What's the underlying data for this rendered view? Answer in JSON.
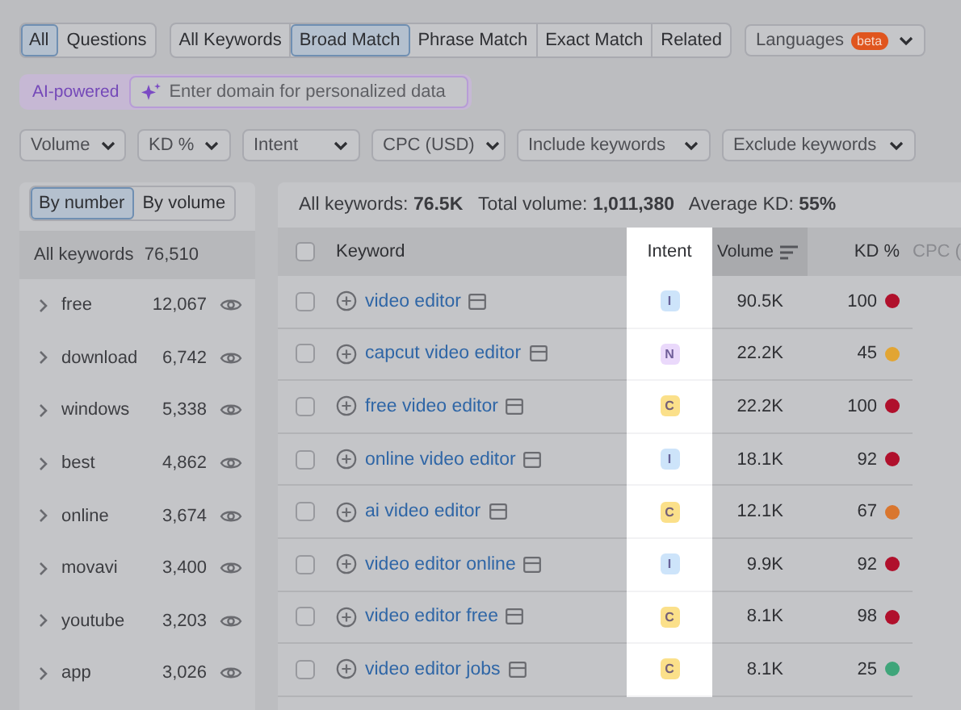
{
  "match_tabs": [
    {
      "label": "All",
      "selected": true
    },
    {
      "label": "Questions",
      "selected": false
    }
  ],
  "type_tabs": [
    {
      "label": "All Keywords",
      "selected": false
    },
    {
      "label": "Broad Match",
      "selected": true
    },
    {
      "label": "Phrase Match",
      "selected": false
    },
    {
      "label": "Exact Match",
      "selected": false
    },
    {
      "label": "Related",
      "selected": false
    }
  ],
  "languages": {
    "label": "Languages",
    "badge": "beta"
  },
  "ai_domain": {
    "label": "AI-powered",
    "placeholder": "Enter domain for personalized data"
  },
  "filters": [
    "Volume",
    "KD %",
    "Intent",
    "CPC (USD)",
    "Include keywords",
    "Exclude keywords"
  ],
  "group_toggle": [
    {
      "label": "By number",
      "selected": true
    },
    {
      "label": "By volume",
      "selected": false
    }
  ],
  "groups_header": {
    "label": "All keywords",
    "count": "76,510"
  },
  "groups": [
    {
      "name": "free",
      "count": "12,067"
    },
    {
      "name": "download",
      "count": "6,742"
    },
    {
      "name": "windows",
      "count": "5,338"
    },
    {
      "name": "best",
      "count": "4,862"
    },
    {
      "name": "online",
      "count": "3,674"
    },
    {
      "name": "movavi",
      "count": "3,400"
    },
    {
      "name": "youtube",
      "count": "3,203"
    },
    {
      "name": "app",
      "count": "3,026"
    }
  ],
  "summary": "All keywords: **76.5K**   Total volume: **1,011,380**   Average KD: **55%**",
  "table": {
    "all_checked": false,
    "columns": [
      {
        "label": "Keyword",
        "sorted": false
      },
      {
        "label": "Intent",
        "sorted": false
      },
      {
        "label": "Volume",
        "sorted": true
      },
      {
        "label": "KD %",
        "sorted": false
      },
      {
        "label": "CPC (",
        "sorted": false
      }
    ],
    "rows": [
      {
        "checked": false,
        "keyword": "video editor",
        "intent": {
          "label": "I",
          "color": "#cde4fa"
        },
        "volume": "90.5K",
        "kd": {
          "value": "100",
          "color": "#b0102c"
        }
      },
      {
        "checked": false,
        "keyword": "capcut video editor",
        "intent": {
          "label": "N",
          "color": "#ead9fb"
        },
        "volume": "22.2K",
        "kd": {
          "value": "45",
          "color": "#e2a533"
        }
      },
      {
        "checked": false,
        "keyword": "free video editor",
        "intent": {
          "label": "C",
          "color": "#fbe08a"
        },
        "volume": "22.2K",
        "kd": {
          "value": "100",
          "color": "#b0102c"
        }
      },
      {
        "checked": false,
        "keyword": "online video editor",
        "intent": {
          "label": "I",
          "color": "#cde4fa"
        },
        "volume": "18.1K",
        "kd": {
          "value": "92",
          "color": "#b0102c"
        }
      },
      {
        "checked": false,
        "keyword": "ai video editor",
        "intent": {
          "label": "C",
          "color": "#fbe08a"
        },
        "volume": "12.1K",
        "kd": {
          "value": "67",
          "color": "#d9762e"
        }
      },
      {
        "checked": false,
        "keyword": "video editor online",
        "intent": {
          "label": "I",
          "color": "#cde4fa"
        },
        "volume": "9.9K",
        "kd": {
          "value": "92",
          "color": "#b0102c"
        }
      },
      {
        "checked": false,
        "keyword": "video editor free",
        "intent": {
          "label": "C",
          "color": "#fbe08a"
        },
        "volume": "8.1K",
        "kd": {
          "value": "98",
          "color": "#b0102c"
        }
      },
      {
        "checked": false,
        "keyword": "video editor jobs",
        "intent": {
          "label": "C",
          "color": "#fbe08a"
        },
        "volume": "8.1K",
        "kd": {
          "value": "25",
          "color": "#3fa57a"
        }
      }
    ]
  }
}
